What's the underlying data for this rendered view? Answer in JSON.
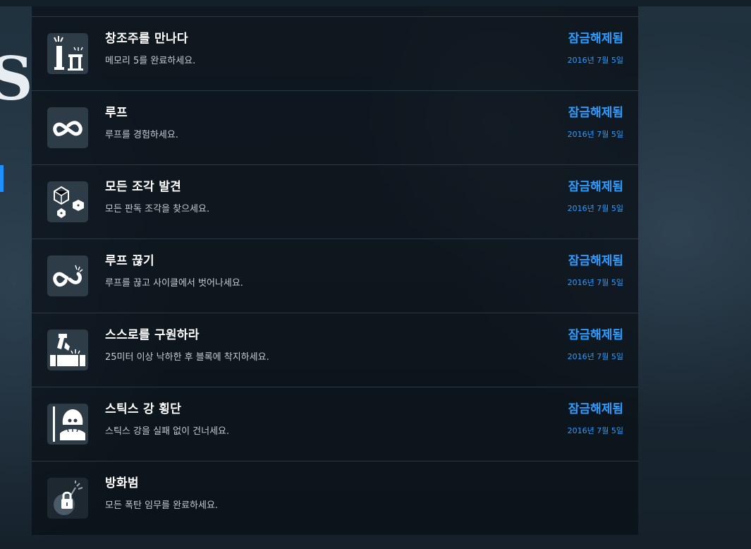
{
  "left_strip": {
    "glyph": "S"
  },
  "achievements": [
    {
      "title": "창조주를 만나다",
      "description": "메모리 5를 완료하세요.",
      "status": "잠금해제됨",
      "date": "2016년 7월 5일",
      "icon": "monument-icon"
    },
    {
      "title": "루프",
      "description": "루프를 경험하세요.",
      "status": "잠금해제됨",
      "date": "2016년 7월 5일",
      "icon": "infinity-loop-icon"
    },
    {
      "title": "모든 조각 발견",
      "description": "모든 판독 조각을 찾으세요.",
      "status": "잠금해제됨",
      "date": "2016년 7월 5일",
      "icon": "cube-fragments-icon"
    },
    {
      "title": "루프 끊기",
      "description": "루프를 끊고 사이클에서 벗어나세요.",
      "status": "잠금해제됨",
      "date": "2016년 7월 5일",
      "icon": "broken-loop-icon"
    },
    {
      "title": "스스로를 구원하라",
      "description": "25미터 이상 낙하한 후 블록에 착지하세요.",
      "status": "잠금해제됨",
      "date": "2016년 7월 5일",
      "icon": "falling-block-icon"
    },
    {
      "title": "스틱스 강 횡단",
      "description": "스틱스 강을 실패 없이 건너세요.",
      "status": "잠금해제됨",
      "date": "2016년 7월 5일",
      "icon": "reaper-icon"
    },
    {
      "title": "방화범",
      "description": "모든 폭탄 임무를 완료하세요.",
      "status": "",
      "date": "",
      "icon": "bomb-lock-icon"
    }
  ],
  "colors": {
    "accent": "#2d9cff",
    "panel": "#0a1117",
    "icon_bg": "#2e3c47"
  }
}
